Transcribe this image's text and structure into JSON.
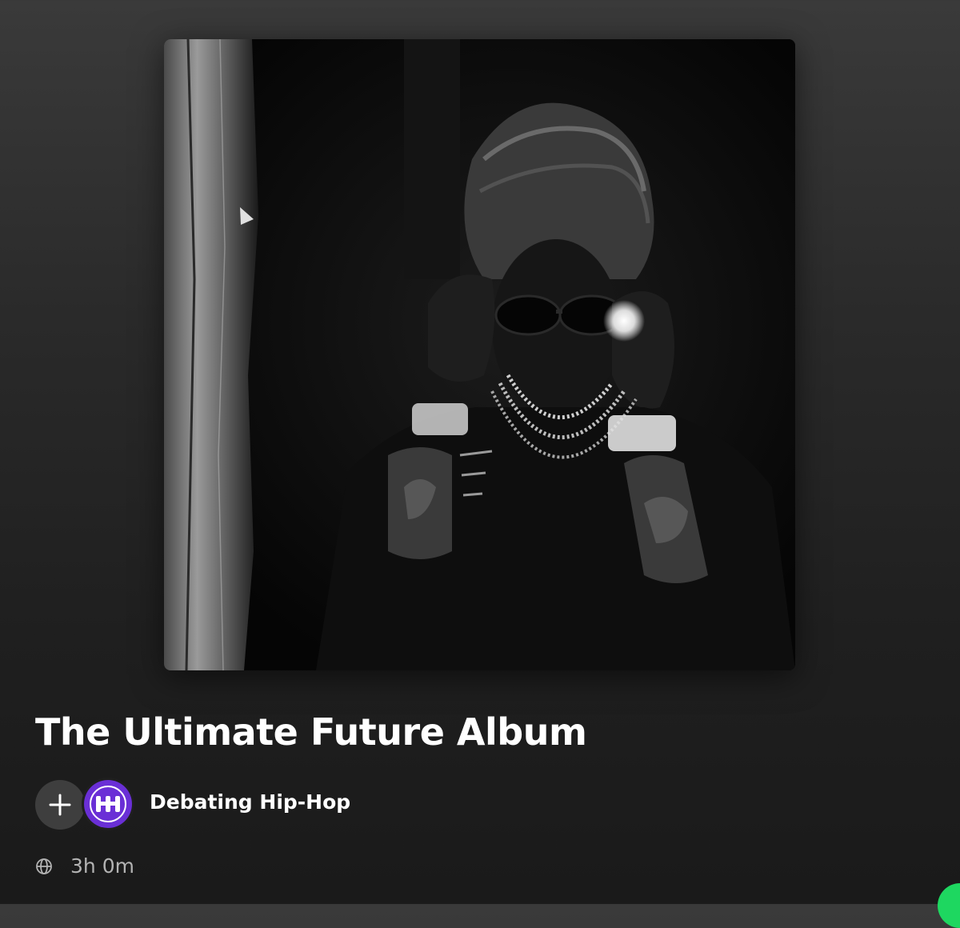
{
  "playlist": {
    "cover_alt": "Playlist cover photo",
    "title": "The Ultimate Future Album",
    "owner": {
      "name": "Debating Hip-Hop",
      "avatar_text": "DHH",
      "avatar_color": "#6a2fd6"
    },
    "visibility_icon": "globe-icon",
    "duration": "3h 0m"
  },
  "actions": {
    "add_icon": "plus-icon"
  },
  "colors": {
    "background_top": "#3a3a3a",
    "background_bottom": "#1a1a1a",
    "text_primary": "#ffffff",
    "text_secondary": "#b3b3b3",
    "accent_green": "#1ed760"
  }
}
